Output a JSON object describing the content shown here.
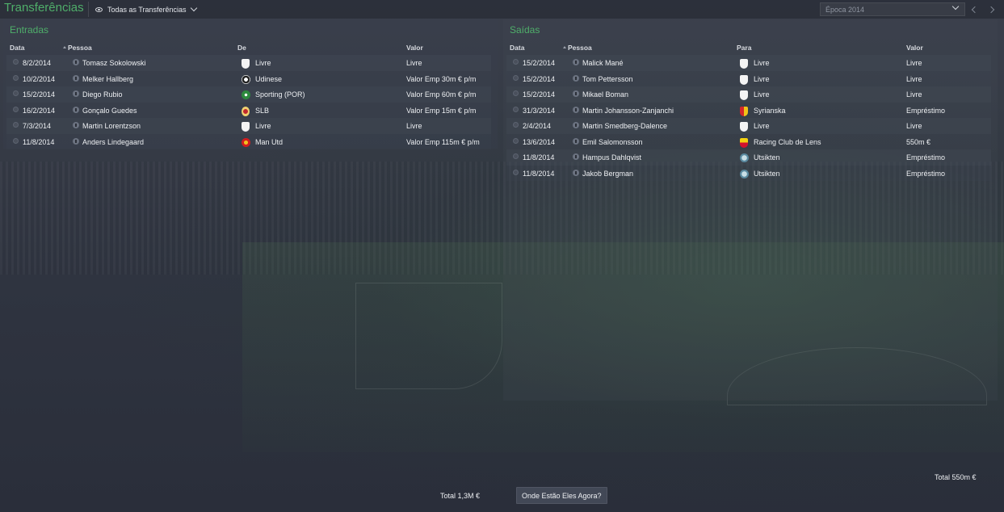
{
  "header": {
    "title": "Transferências",
    "filter_label": "Todas as Transferências",
    "season_placeholder": "Época 2014"
  },
  "entradas": {
    "title": "Entradas",
    "columns": {
      "date": "Data",
      "person": "Pessoa",
      "from": "De",
      "value": "Valor"
    },
    "rows": [
      {
        "date": "8/2/2014",
        "person": "Tomasz Sokolowski",
        "club": "Livre",
        "club_crest": "shield",
        "value": "Livre"
      },
      {
        "date": "10/2/2014",
        "person": "Melker Hallberg",
        "club": "Udinese",
        "club_crest": "udinese",
        "value": "Valor Emp 30m € p/m"
      },
      {
        "date": "15/2/2014",
        "person": "Diego Rubio",
        "club": "Sporting (POR)",
        "club_crest": "sporting",
        "value": "Valor Emp 60m € p/m"
      },
      {
        "date": "16/2/2014",
        "person": "Gonçalo Guedes",
        "club": "SLB",
        "club_crest": "slb",
        "value": "Valor Emp 15m € p/m"
      },
      {
        "date": "7/3/2014",
        "person": "Martin Lorentzson",
        "club": "Livre",
        "club_crest": "shield",
        "value": "Livre"
      },
      {
        "date": "11/8/2014",
        "person": "Anders Lindegaard",
        "club": "Man Utd",
        "club_crest": "manutd",
        "value": "Valor Emp 115m € p/m"
      }
    ],
    "total_label": "Total",
    "total_value": "1,3M €"
  },
  "saidas": {
    "title": "Saídas",
    "columns": {
      "date": "Data",
      "person": "Pessoa",
      "to": "Para",
      "value": "Valor"
    },
    "rows": [
      {
        "date": "15/2/2014",
        "person": "Malick Mané",
        "club": "Livre",
        "club_crest": "shield",
        "value": "Livre"
      },
      {
        "date": "15/2/2014",
        "person": "Tom Pettersson",
        "club": "Livre",
        "club_crest": "shield",
        "value": "Livre"
      },
      {
        "date": "15/2/2014",
        "person": "Mikael Boman",
        "club": "Livre",
        "club_crest": "shield",
        "value": "Livre"
      },
      {
        "date": "31/3/2014",
        "person": "Martin Johansson-Zanjanchi",
        "club": "Syrianska",
        "club_crest": "syrianska",
        "value": "Empréstimo"
      },
      {
        "date": "2/4/2014",
        "person": "Martin Smedberg-Dalence",
        "club": "Livre",
        "club_crest": "shield",
        "value": "Livre"
      },
      {
        "date": "13/6/2014",
        "person": "Emil Salomonsson",
        "club": "Racing Club de Lens",
        "club_crest": "lens",
        "value": "550m €"
      },
      {
        "date": "11/8/2014",
        "person": "Hampus Dahlqvist",
        "club": "Utsikten",
        "club_crest": "utsikten",
        "value": "Empréstimo"
      },
      {
        "date": "11/8/2014",
        "person": "Jakob Bergman",
        "club": "Utsikten",
        "club_crest": "utsikten",
        "value": "Empréstimo"
      }
    ],
    "total_label": "Total",
    "total_value": "550m €"
  },
  "footer": {
    "where_button": "Onde Estão Eles Agora?"
  },
  "colors": {
    "accent_green": "#4fae6a",
    "background": "#2f3440"
  }
}
